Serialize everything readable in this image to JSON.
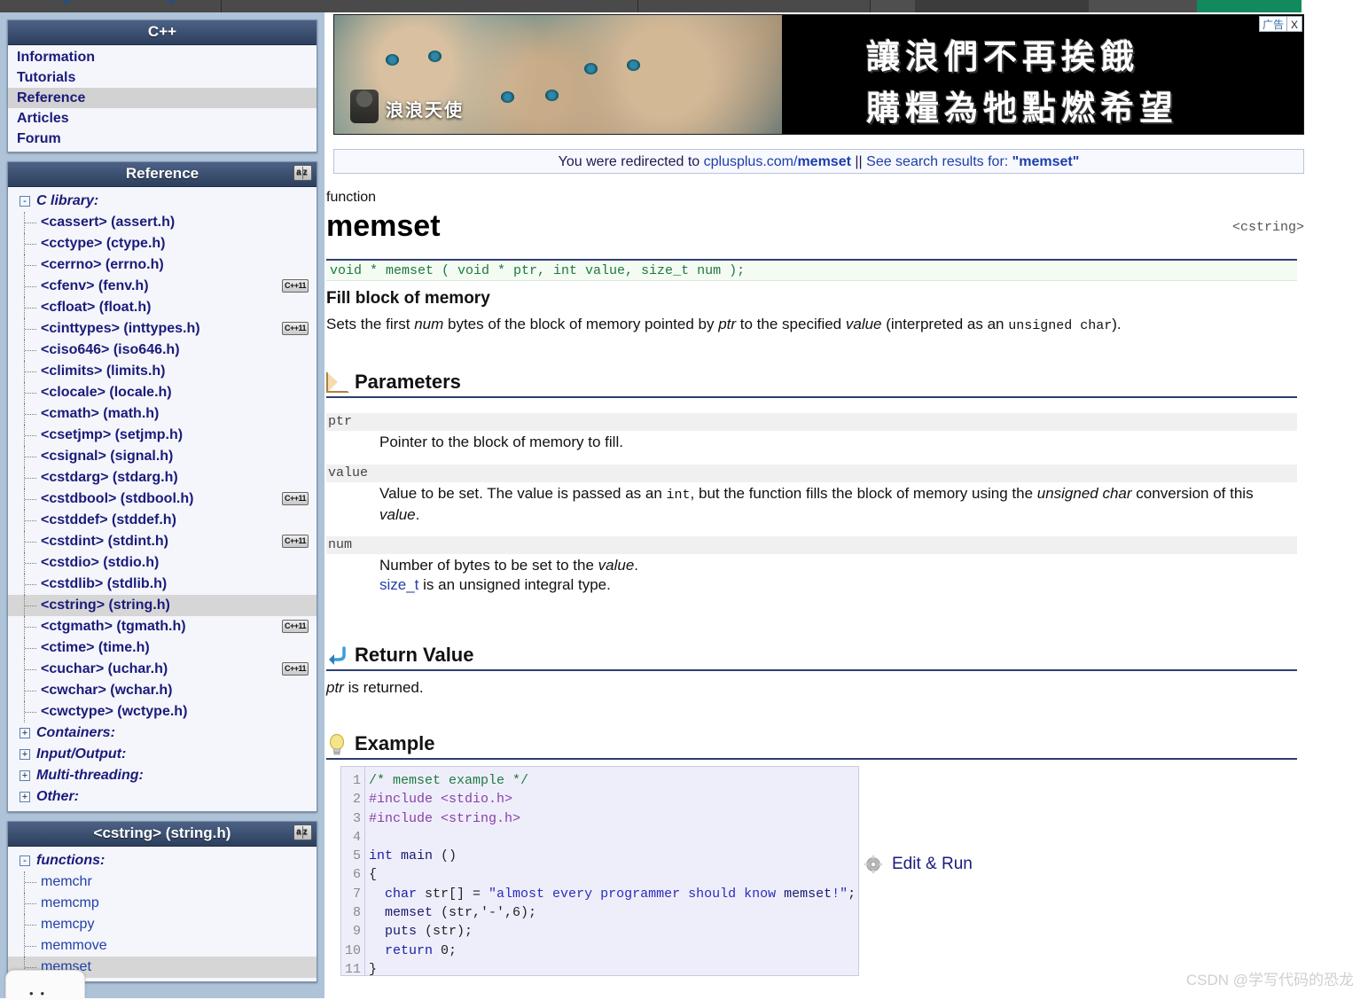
{
  "browser_toolbar": {
    "visible": true,
    "note": "partially cut off toolbar strip at top of screenshot"
  },
  "sidebar": {
    "nav_panel": {
      "title": "C++",
      "items": [
        {
          "label": "Information",
          "selected": false
        },
        {
          "label": "Tutorials",
          "selected": false
        },
        {
          "label": "Reference",
          "selected": true
        },
        {
          "label": "Articles",
          "selected": false
        },
        {
          "label": "Forum",
          "selected": false
        }
      ]
    },
    "reference_panel": {
      "title": "Reference",
      "sort_icon": "a-z-sort-icon",
      "tree": [
        {
          "label": "C library:",
          "type": "group",
          "toggle": "-",
          "selected": false,
          "cpp11": false
        },
        {
          "label": "<cassert> (assert.h)",
          "type": "leaf",
          "selected": false,
          "cpp11": false
        },
        {
          "label": "<cctype> (ctype.h)",
          "type": "leaf",
          "selected": false,
          "cpp11": false
        },
        {
          "label": "<cerrno> (errno.h)",
          "type": "leaf",
          "selected": false,
          "cpp11": false
        },
        {
          "label": "<cfenv> (fenv.h)",
          "type": "leaf",
          "selected": false,
          "cpp11": true
        },
        {
          "label": "<cfloat> (float.h)",
          "type": "leaf",
          "selected": false,
          "cpp11": false
        },
        {
          "label": "<cinttypes> (inttypes.h)",
          "type": "leaf",
          "selected": false,
          "cpp11": true
        },
        {
          "label": "<ciso646> (iso646.h)",
          "type": "leaf",
          "selected": false,
          "cpp11": false
        },
        {
          "label": "<climits> (limits.h)",
          "type": "leaf",
          "selected": false,
          "cpp11": false
        },
        {
          "label": "<clocale> (locale.h)",
          "type": "leaf",
          "selected": false,
          "cpp11": false
        },
        {
          "label": "<cmath> (math.h)",
          "type": "leaf",
          "selected": false,
          "cpp11": false
        },
        {
          "label": "<csetjmp> (setjmp.h)",
          "type": "leaf",
          "selected": false,
          "cpp11": false
        },
        {
          "label": "<csignal> (signal.h)",
          "type": "leaf",
          "selected": false,
          "cpp11": false
        },
        {
          "label": "<cstdarg> (stdarg.h)",
          "type": "leaf",
          "selected": false,
          "cpp11": false
        },
        {
          "label": "<cstdbool> (stdbool.h)",
          "type": "leaf",
          "selected": false,
          "cpp11": true
        },
        {
          "label": "<cstddef> (stddef.h)",
          "type": "leaf",
          "selected": false,
          "cpp11": false
        },
        {
          "label": "<cstdint> (stdint.h)",
          "type": "leaf",
          "selected": false,
          "cpp11": true
        },
        {
          "label": "<cstdio> (stdio.h)",
          "type": "leaf",
          "selected": false,
          "cpp11": false
        },
        {
          "label": "<cstdlib> (stdlib.h)",
          "type": "leaf",
          "selected": false,
          "cpp11": false
        },
        {
          "label": "<cstring> (string.h)",
          "type": "leaf",
          "selected": true,
          "cpp11": false
        },
        {
          "label": "<ctgmath> (tgmath.h)",
          "type": "leaf",
          "selected": false,
          "cpp11": true
        },
        {
          "label": "<ctime> (time.h)",
          "type": "leaf",
          "selected": false,
          "cpp11": false
        },
        {
          "label": "<cuchar> (uchar.h)",
          "type": "leaf",
          "selected": false,
          "cpp11": true
        },
        {
          "label": "<cwchar> (wchar.h)",
          "type": "leaf",
          "selected": false,
          "cpp11": false
        },
        {
          "label": "<cwctype> (wctype.h)",
          "type": "leaf",
          "selected": false,
          "cpp11": false
        },
        {
          "label": "Containers:",
          "type": "group",
          "toggle": "+",
          "selected": false,
          "cpp11": false
        },
        {
          "label": "Input/Output:",
          "type": "group",
          "toggle": "+",
          "selected": false,
          "cpp11": false
        },
        {
          "label": "Multi-threading:",
          "type": "group",
          "toggle": "+",
          "selected": false,
          "cpp11": false
        },
        {
          "label": "Other:",
          "type": "group",
          "toggle": "+",
          "selected": false,
          "cpp11": false
        }
      ]
    },
    "header_panel": {
      "title": "<cstring> (string.h)",
      "sort_icon": "a-z-sort-icon",
      "tree": [
        {
          "label": "functions:",
          "type": "group",
          "toggle": "-",
          "selected": false
        },
        {
          "label": "memchr",
          "type": "fn",
          "selected": false
        },
        {
          "label": "memcmp",
          "type": "fn",
          "selected": false
        },
        {
          "label": "memcpy",
          "type": "fn",
          "selected": false
        },
        {
          "label": "memmove",
          "type": "fn",
          "selected": false
        },
        {
          "label": "memset",
          "type": "fn",
          "selected": true
        }
      ]
    }
  },
  "banner_ad": {
    "brand": "浪浪天使",
    "line1": "讓浪們不再挨餓",
    "line2": "購糧為牠點燃希望",
    "ad_label": "广告",
    "close_label": "X"
  },
  "redirect_notice": {
    "prefix": "You were redirected to ",
    "domain": "cplusplus.com/",
    "target": "memset",
    "separator": " || ",
    "search_prefix": "See search results for: ",
    "search_term": "\"memset\""
  },
  "article": {
    "kind": "function",
    "title": "memset",
    "header_ref": "<cstring>",
    "signature": "void * memset ( void * ptr, int value, size_t num );",
    "brief": "Fill block of memory",
    "description": {
      "p1": "Sets the first ",
      "i1": "num",
      "p2": " bytes of the block of memory pointed by ",
      "i2": "ptr",
      "p3": " to the specified ",
      "i3": "value",
      "p4": " (interpreted as an ",
      "m1": "unsigned char",
      "p5": ")."
    },
    "sections": {
      "parameters": "Parameters",
      "return_value": "Return Value",
      "example": "Example"
    },
    "parameters": [
      {
        "name": "ptr",
        "desc_parts": [
          {
            "t": "Pointer to the block of memory to fill.",
            "s": "n"
          }
        ]
      },
      {
        "name": "value",
        "desc_parts": [
          {
            "t": "Value to be set. The value is passed as an ",
            "s": "n"
          },
          {
            "t": "int",
            "s": "m"
          },
          {
            "t": ", but the function fills the block of memory using the ",
            "s": "n"
          },
          {
            "t": "unsigned char",
            "s": "i"
          },
          {
            "t": " conversion of this ",
            "s": "n"
          },
          {
            "t": "value",
            "s": "i"
          },
          {
            "t": ".",
            "s": "n"
          }
        ]
      },
      {
        "name": "num",
        "desc_parts": [
          {
            "t": "Number of bytes to be set to the ",
            "s": "n"
          },
          {
            "t": "value",
            "s": "i"
          },
          {
            "t": ".",
            "s": "n"
          },
          {
            "t": "\n",
            "s": "br"
          },
          {
            "t": "size_t",
            "s": "link"
          },
          {
            "t": " is an unsigned integral type.",
            "s": "n"
          }
        ]
      }
    ],
    "return_value_text_italic": "ptr",
    "return_value_text_rest": " is returned.",
    "example": {
      "line_numbers": [
        "1",
        "2",
        "3",
        "4",
        "5",
        "6",
        "7",
        "8",
        "9",
        "10",
        "11"
      ],
      "code_lines": [
        "/* memset example */",
        "#include <stdio.h>",
        "#include <string.h>",
        "",
        "int main ()",
        "{",
        "  char str[] = \"almost every programmer should know memset!\";",
        "  memset (str,'-',6);",
        "  puts (str);",
        "  return 0;",
        "}"
      ],
      "edit_run_label": "Edit & Run",
      "gear_icon": "gear-icon"
    }
  },
  "watermark": "CSDN @学写代码的恐龙",
  "colors": {
    "panel_header_top": "#4c6285",
    "panel_header_bottom": "#2d3f5e",
    "sidebar_bg": "#aec3d8",
    "link_blue": "#1b1b7a",
    "selected_row": "#d6d6d6",
    "signature_bg": "#f3fbf3",
    "signature_text": "#1d7a3c",
    "code_bg": "#eeeefb",
    "section_rule": "#2d3f6e"
  }
}
